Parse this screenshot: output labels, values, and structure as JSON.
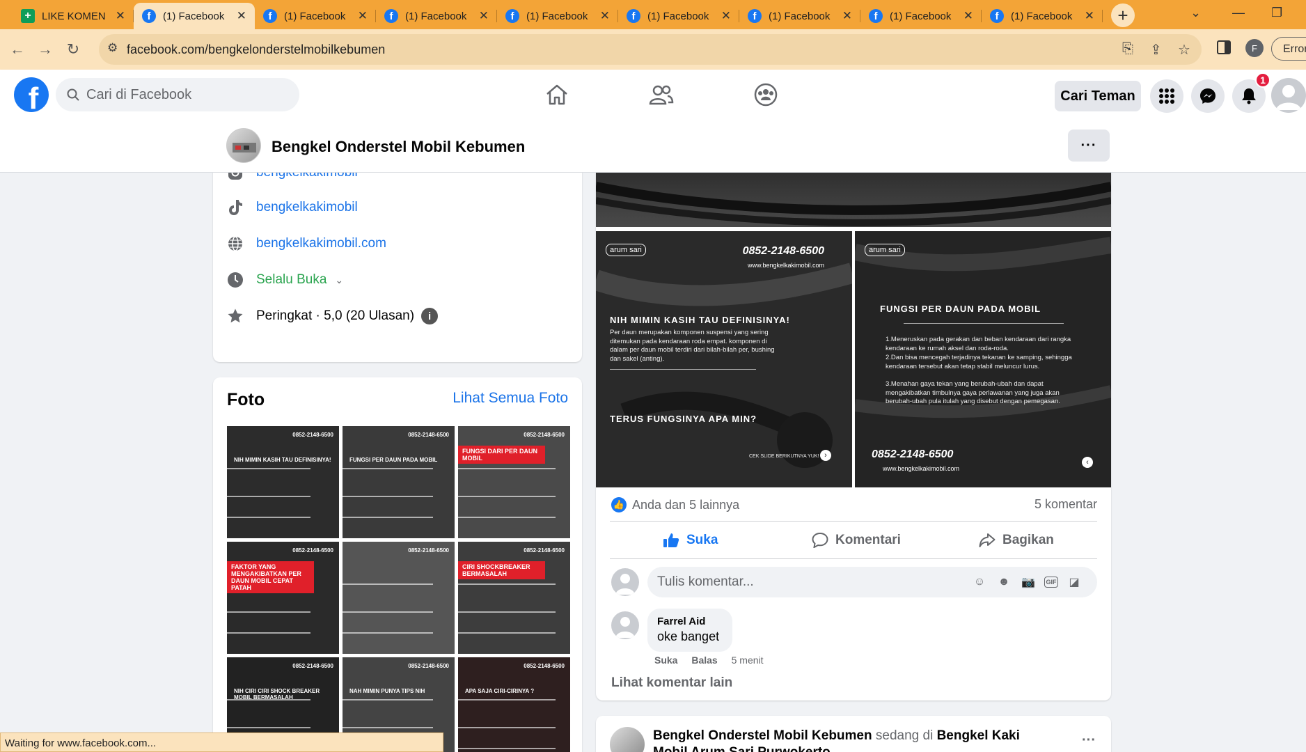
{
  "browser": {
    "tabs": [
      {
        "title": "LIKE KOMEN",
        "icon": "sheets-plus-icon",
        "active": false
      },
      {
        "title": "(1) Facebook",
        "icon": "facebook-icon",
        "active": true
      },
      {
        "title": "(1) Facebook",
        "icon": "facebook-icon",
        "active": false
      },
      {
        "title": "(1) Facebook",
        "icon": "facebook-icon",
        "active": false
      },
      {
        "title": "(1) Facebook",
        "icon": "facebook-icon",
        "active": false
      },
      {
        "title": "(1) Facebook",
        "icon": "facebook-icon",
        "active": false
      },
      {
        "title": "(1) Facebook",
        "icon": "facebook-icon",
        "active": false
      },
      {
        "title": "(1) Facebook",
        "icon": "facebook-icon",
        "active": false
      },
      {
        "title": "(1) Facebook",
        "icon": "facebook-icon",
        "active": false
      }
    ],
    "url": "facebook.com/bengkelonderstelmobilkebumen",
    "profile_initial": "F",
    "error_label": "Error",
    "status_text": "Waiting for www.facebook.com...",
    "colors": {
      "tabstrip": "#f3a437",
      "toolbar": "#fbe3bd"
    }
  },
  "fb": {
    "search_placeholder": "Cari di Facebook",
    "find_friends": "Cari Teman",
    "notification_count": "1",
    "brand_color": "#1877f2"
  },
  "page": {
    "name": "Bengkel Onderstel Mobil Kebumen",
    "more_label": "···"
  },
  "intro": {
    "items": [
      {
        "icon": "instagram-icon",
        "text": "bengkelkakimobil"
      },
      {
        "icon": "tiktok-icon",
        "text": "bengkelkakimobil"
      },
      {
        "icon": "globe-icon",
        "text": "bengkelkakimobil.com"
      },
      {
        "icon": "clock-icon",
        "text": "Selalu Buka"
      },
      {
        "icon": "star-icon",
        "text": "Peringkat · 5,0 (20 Ulasan)"
      }
    ]
  },
  "photos": {
    "title": "Foto",
    "see_all": "Lihat Semua Foto",
    "thumbs": [
      {
        "heading": "NIH MIMIN KASIH TAU DEFINISINYA!",
        "banner": ""
      },
      {
        "heading": "FUNGSI PER DAUN PADA MOBIL",
        "banner": ""
      },
      {
        "heading": "",
        "banner": "FUNGSI DARI PER DAUN MOBIL"
      },
      {
        "heading": "",
        "banner": "FAKTOR YANG MENGAKIBATKAN PER DAUN MOBIL CEPAT PATAH"
      },
      {
        "heading": "",
        "banner": ""
      },
      {
        "heading": "",
        "banner": "CIRI SHOCKBREAKER BERMASALAH"
      },
      {
        "heading": "NIH CIRI CIRI SHOCK BREAKER MOBIL BERMASALAH",
        "banner": ""
      },
      {
        "heading": "NAH MIMIN PUNYA TIPS NIH",
        "banner": ""
      },
      {
        "heading": "APA SAJA CIRI-CIRINYA ?",
        "banner": ""
      }
    ],
    "phone": "0852-2148-6500"
  },
  "post": {
    "images": [
      {
        "logo": "arum sari",
        "phone": "0852-2148-6500",
        "web": "www.bengkelkakimobil.com",
        "heading": "NIH MIMIN KASIH TAU DEFINISINYA!",
        "body": "Per daun merupakan komponen suspensi yang sering ditemukan pada kendaraan roda empat. komponen di dalam per daun mobil terdiri dari bilah-bilah per, bushing dan sakel (anting).",
        "heading2": "TERUS FUNGSINYA APA MIN?",
        "footer": "CEK SLIDE BERIKUTNYA YUK!"
      },
      {
        "logo": "arum sari",
        "heading": "FUNGSI PER DAUN PADA MOBIL",
        "list": [
          "1.Meneruskan pada gerakan dan beban kendaraan dari rangka kendaraan ke rumah aksel dan roda-roda.",
          "2.Dan bisa mencegah terjadinya tekanan ke samping, sehingga kendaraan tersebut akan tetap stabil meluncur lurus.",
          "3.Menahan gaya tekan yang berubah-ubah dan dapat mengakibatkan timbulnya gaya perlawanan yang juga akan berubah-ubah pula itulah yang disebut dengan pemegasan."
        ],
        "phone": "0852-2148-6500",
        "web": "www.bengkelkakimobil.com"
      }
    ],
    "reactions_text": "Anda dan 5 lainnya",
    "comments_count": "5 komentar",
    "actions": {
      "like": "Suka",
      "comment": "Komentari",
      "share": "Bagikan"
    },
    "comment_placeholder": "Tulis komentar...",
    "comment": {
      "author": "Farrel Aid",
      "text": "oke banget",
      "like": "Suka",
      "reply": "Balas",
      "time": "5 menit"
    },
    "more_comments": "Lihat komentar lain"
  },
  "post2": {
    "author": "Bengkel Onderstel Mobil Kebumen",
    "connector": "sedang di",
    "location": "Bengkel Kaki Mobil Arum Sari Purwokerto"
  }
}
